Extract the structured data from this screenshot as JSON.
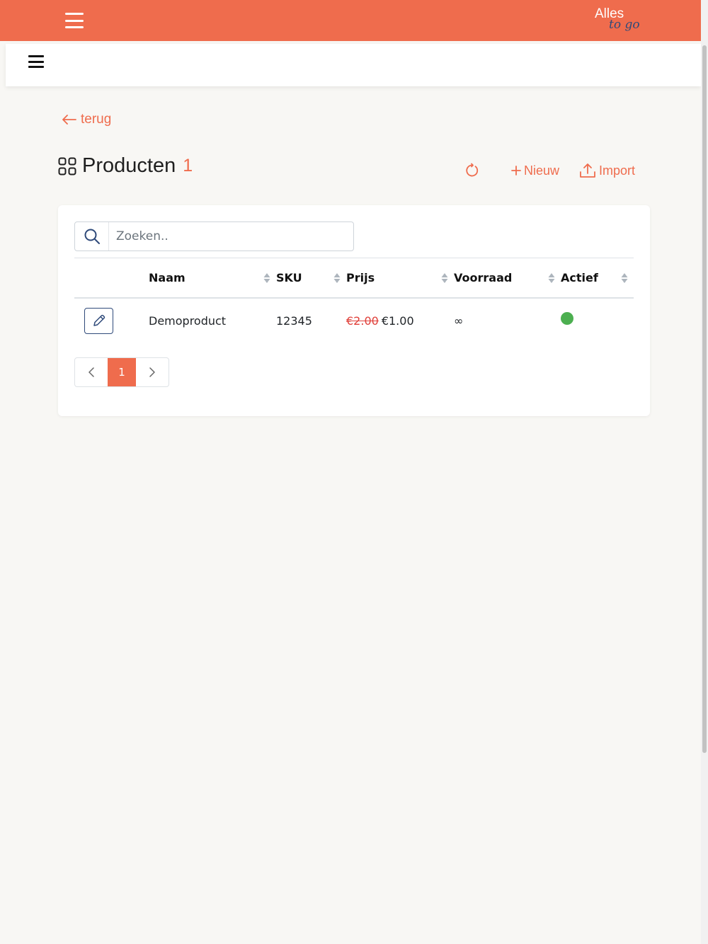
{
  "header": {
    "brand_primary": "Alles",
    "brand_secondary": "to go",
    "accent_color": "#ef6c4d",
    "brand_secondary_color": "#2f4a7a"
  },
  "nav": {
    "back_label": "terug"
  },
  "page": {
    "title": "Producten",
    "count": "1"
  },
  "actions": {
    "new_label": "Nieuw",
    "import_label": "Import"
  },
  "search": {
    "placeholder": "Zoeken..",
    "value": ""
  },
  "table": {
    "columns": [
      "Naam",
      "SKU",
      "Prijs",
      "Voorraad",
      "Actief"
    ],
    "rows": [
      {
        "name": "Demoproduct",
        "sku": "12345",
        "old_price": "€2.00",
        "price": "€1.00",
        "stock": "∞",
        "active": true,
        "active_color": "#4caf50"
      }
    ]
  },
  "pagination": {
    "current_page": "1"
  },
  "icons": {
    "menu": "hamburger-menu-icon",
    "back": "arrow-left-icon",
    "products": "grid-icon",
    "refresh": "refresh-icon",
    "new": "plus-icon",
    "import": "upload-icon",
    "search": "search-icon",
    "edit": "pencil-icon",
    "sort": "sort-icon",
    "prev": "chevron-left-icon",
    "next": "chevron-right-icon"
  }
}
